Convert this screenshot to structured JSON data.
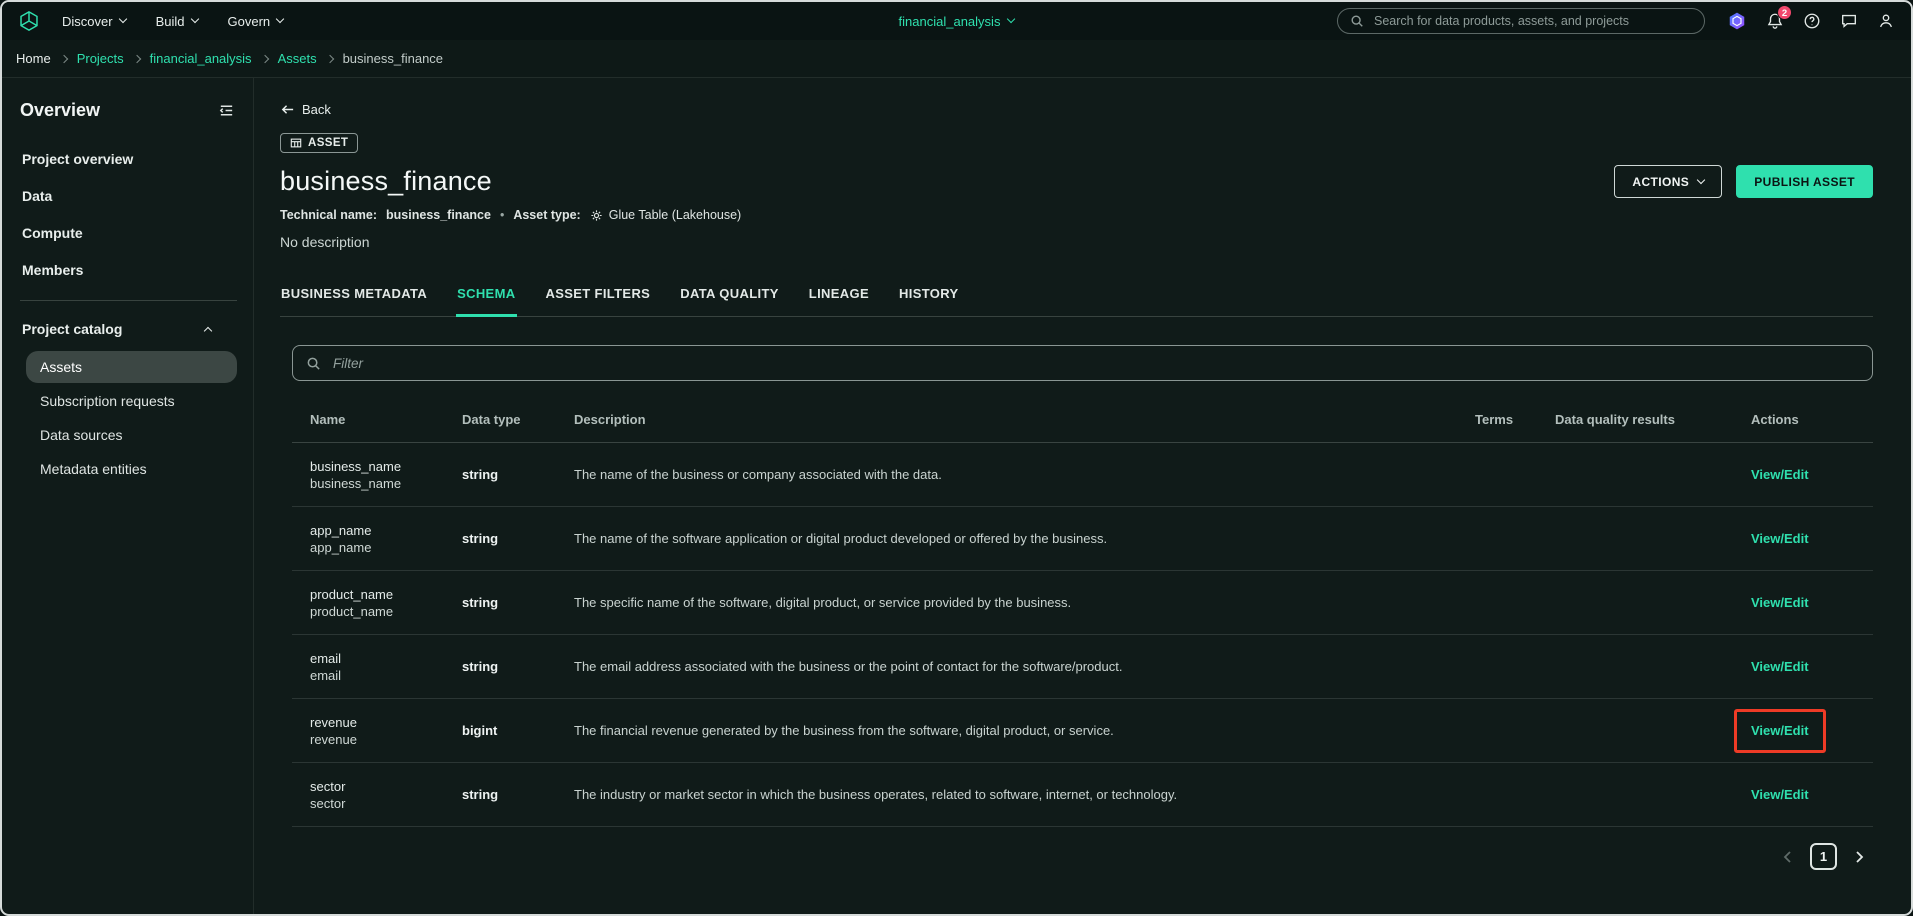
{
  "colors": {
    "accent": "#2fe0ae",
    "annotation": "#ee3b26",
    "badge": "#f2486d"
  },
  "topnav": {
    "menus": [
      "Discover",
      "Build",
      "Govern"
    ],
    "project_selector": "financial_analysis",
    "search_placeholder": "Search for data products, assets, and projects",
    "notification_count": "2"
  },
  "breadcrumb": [
    "Home",
    "Projects",
    "financial_analysis",
    "Assets",
    "business_finance"
  ],
  "sidebar": {
    "title": "Overview",
    "items": [
      "Project overview",
      "Data",
      "Compute",
      "Members"
    ],
    "catalog": {
      "label": "Project catalog",
      "items": [
        "Assets",
        "Subscription requests",
        "Data sources",
        "Metadata entities"
      ]
    }
  },
  "main": {
    "back_label": "Back",
    "asset_badge": "ASSET",
    "title": "business_finance",
    "technical_name_label": "Technical name:",
    "technical_name_value": "business_finance",
    "meta_separator": "•",
    "asset_type_label": "Asset type:",
    "asset_type_value": "Glue Table (Lakehouse)",
    "description": "No description",
    "actions_label": "ACTIONS",
    "publish_label": "PUBLISH ASSET",
    "tabs": [
      "BUSINESS METADATA",
      "SCHEMA",
      "ASSET FILTERS",
      "DATA QUALITY",
      "LINEAGE",
      "HISTORY"
    ],
    "active_tab": "SCHEMA",
    "filter_placeholder": "Filter",
    "table": {
      "columns": [
        "Name",
        "Data type",
        "Description",
        "Terms",
        "Data quality results",
        "Actions"
      ],
      "rows": [
        {
          "name": "business_name",
          "technical_name": "business_name",
          "data_type": "string",
          "description": "The name of the business or company associated with the data.",
          "action": "View/Edit",
          "highlight": false
        },
        {
          "name": "app_name",
          "technical_name": "app_name",
          "data_type": "string",
          "description": "The name of the software application or digital product developed or offered by the business.",
          "action": "View/Edit",
          "highlight": false
        },
        {
          "name": "product_name",
          "technical_name": "product_name",
          "data_type": "string",
          "description": "The specific name of the software, digital product, or service provided by the business.",
          "action": "View/Edit",
          "highlight": false
        },
        {
          "name": "email",
          "technical_name": "email",
          "data_type": "string",
          "description": "The email address associated with the business or the point of contact for the software/product.",
          "action": "View/Edit",
          "highlight": false
        },
        {
          "name": "revenue",
          "technical_name": "revenue",
          "data_type": "bigint",
          "description": "The financial revenue generated by the business from the software, digital product, or service.",
          "action": "View/Edit",
          "highlight": true
        },
        {
          "name": "sector",
          "technical_name": "sector",
          "data_type": "string",
          "description": "The industry or market sector in which the business operates, related to software, internet, or technology.",
          "action": "View/Edit",
          "highlight": false
        }
      ]
    },
    "pagination": {
      "current_page": "1"
    }
  }
}
